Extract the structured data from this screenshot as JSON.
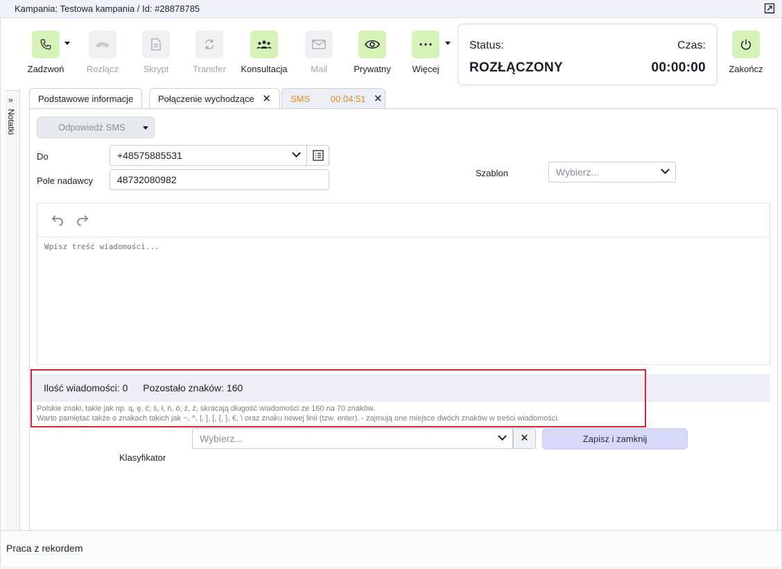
{
  "window": {
    "title": "Kampania: Testowa kampania / Id: #28878785"
  },
  "toolbar": {
    "buttons": [
      {
        "label": "Zadzwoń",
        "icon": "phone-icon",
        "enabled": true
      },
      {
        "label": "Rozłącz",
        "icon": "hangup-icon",
        "enabled": false
      },
      {
        "label": "Skrypt",
        "icon": "script-icon",
        "enabled": false
      },
      {
        "label": "Transfer",
        "icon": "transfer-icon",
        "enabled": false
      },
      {
        "label": "Konsultacja",
        "icon": "consultation-icon",
        "enabled": true
      },
      {
        "label": "Mail",
        "icon": "mail-icon",
        "enabled": false
      },
      {
        "label": "Prywatny",
        "icon": "eye-icon",
        "enabled": true
      },
      {
        "label": "Więcej",
        "icon": "more-icon",
        "enabled": true
      },
      {
        "label": "Zakończ",
        "icon": "power-icon",
        "enabled": true
      }
    ],
    "status_label": "Status:",
    "status_value": "ROZŁĄCZONY",
    "time_label": "Czas:",
    "time_value": "00:00:00"
  },
  "side_panel": {
    "label": "Notatki"
  },
  "tabs": [
    {
      "label": "Podstawowe informacje"
    },
    {
      "label": "Połączenie wychodzące"
    },
    {
      "label": "SMS",
      "timer": "00:04:51"
    }
  ],
  "sms_form": {
    "reply_button": "Odpowiedź SMS",
    "to_label": "Do",
    "to_value": "+48575885531",
    "sender_label": "Pole nadawcy",
    "sender_value": "48732080982",
    "template_label": "Szablon",
    "template_placeholder": "Wybierz...",
    "message_placeholder": "Wpisz treść wiadomości...",
    "count_label": "Ilość wiadomości: 0",
    "remaining_label": "Pozostało znaków: 160",
    "hint_line1": "Polskie znaki, takie jak np. ą, ę, ć, ś, ł, ń, ó, ż, ź, skracają długość wiadomości ze 160 na 70 znaków.",
    "hint_line2": "Warto pamiętać także o znakach takich jak ~, ^, |, ], [, {, }, €, \\ oraz znaku nowej linii (tzw. enter). - zajmują one miejsce dwóch znaków w treści wiadomości.",
    "classifier_label": "Klasyfikator",
    "classifier_placeholder": "Wybierz...",
    "save_button": "Zapisz i zamknij"
  },
  "footer": {
    "label": "Praca z rekordem"
  },
  "colors": {
    "active_button_bg": "#d7f2b9",
    "sms_tab_timer": "#e58a23",
    "highlight_frame": "#d9262c",
    "save_button_bg": "#d6d9f7"
  }
}
